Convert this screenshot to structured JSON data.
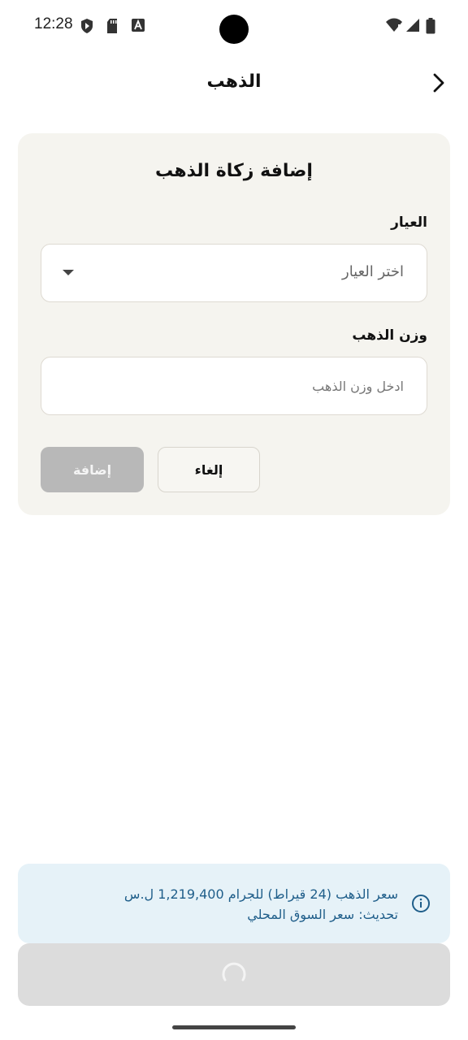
{
  "status_bar": {
    "time": "12:28",
    "left_icons": [
      "play-protect-icon",
      "sd-card-icon",
      "font-a-icon"
    ],
    "right_icons": [
      "wifi-icon",
      "signal-icon",
      "battery-icon"
    ]
  },
  "header": {
    "title": "الذهب",
    "back_icon": "chevron-right-icon"
  },
  "form": {
    "title": "إضافة زكاة الذهب",
    "karat_label": "العيار",
    "karat_value": "اختر العيار",
    "weight_label": "وزن الذهب",
    "weight_placeholder": "ادخل وزن الذهب",
    "weight_value": "",
    "cancel_label": "إلغاء",
    "add_label": "إضافة"
  },
  "info": {
    "price_line": "سعر الذهب (24 قيراط) للجرام 1,219,400 ل.س",
    "update_line": "تحديث: سعر السوق المحلي",
    "icon": "info-icon",
    "color": "#1f5e8a"
  },
  "loading": {
    "icon": "spinner-icon"
  },
  "colors": {
    "card_bg": "#f5f4ef",
    "info_bg": "#e6f2f8",
    "disabled_button": "#b8b8b8"
  }
}
